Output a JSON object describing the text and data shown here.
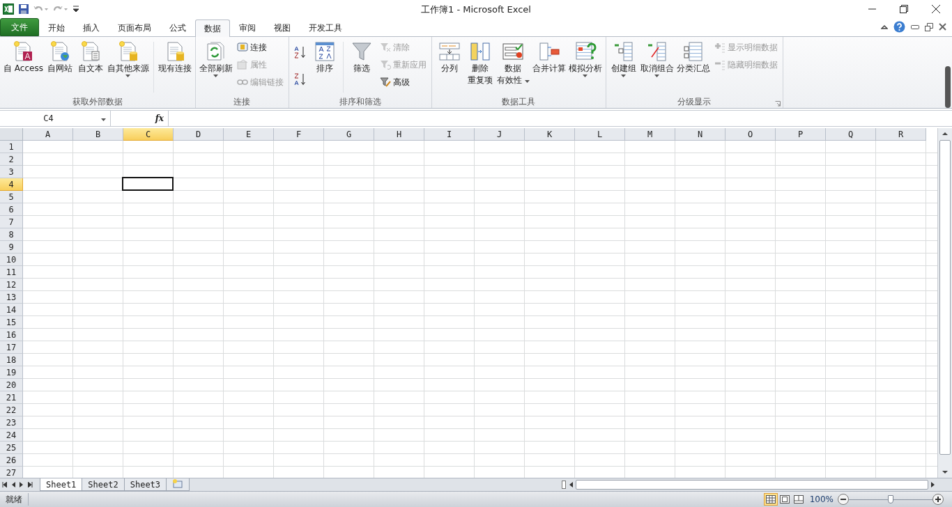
{
  "window": {
    "title": "工作簿1  -  Microsoft Excel"
  },
  "tabs": [
    {
      "label": "文件",
      "kind": "file",
      "selected": false
    },
    {
      "label": "开始",
      "kind": "tab",
      "selected": false
    },
    {
      "label": "插入",
      "kind": "tab",
      "selected": false
    },
    {
      "label": "页面布局",
      "kind": "tab",
      "selected": false
    },
    {
      "label": "公式",
      "kind": "tab",
      "selected": false
    },
    {
      "label": "数据",
      "kind": "tab",
      "selected": true
    },
    {
      "label": "审阅",
      "kind": "tab",
      "selected": false
    },
    {
      "label": "视图",
      "kind": "tab",
      "selected": false
    },
    {
      "label": "开发工具",
      "kind": "tab",
      "selected": false
    }
  ],
  "ribbon": {
    "groups": [
      {
        "label": "获取外部数据",
        "launcher": false,
        "items": [
          {
            "kind": "large",
            "lines": [
              "自 Access"
            ],
            "dropdown": false
          },
          {
            "kind": "large",
            "lines": [
              "自网站"
            ],
            "dropdown": false
          },
          {
            "kind": "large",
            "lines": [
              "自文本"
            ],
            "dropdown": false
          },
          {
            "kind": "large",
            "lines": [
              "自其他来源"
            ],
            "dropdown": true
          },
          {
            "kind": "separator"
          },
          {
            "kind": "large",
            "lines": [
              "现有连接"
            ],
            "dropdown": false
          }
        ]
      },
      {
        "label": "连接",
        "launcher": false,
        "items": [
          {
            "kind": "large",
            "lines": [
              "全部刷新"
            ],
            "dropdown": true
          },
          {
            "kind": "stack",
            "buttons": [
              {
                "label": "连接",
                "disabled": false
              },
              {
                "label": "属性",
                "disabled": true
              },
              {
                "label": "编辑链接",
                "disabled": true
              }
            ]
          }
        ]
      },
      {
        "label": "排序和筛选",
        "launcher": false,
        "items": [
          {
            "kind": "sort-pair"
          },
          {
            "kind": "large",
            "lines": [
              "排序"
            ],
            "dropdown": false
          },
          {
            "kind": "separator"
          },
          {
            "kind": "large",
            "lines": [
              "筛选"
            ],
            "dropdown": false
          },
          {
            "kind": "stack",
            "buttons": [
              {
                "label": "清除",
                "disabled": true
              },
              {
                "label": "重新应用",
                "disabled": true
              },
              {
                "label": "高级",
                "disabled": false
              }
            ]
          }
        ]
      },
      {
        "label": "数据工具",
        "launcher": false,
        "items": [
          {
            "kind": "large",
            "lines": [
              "分列"
            ],
            "dropdown": false
          },
          {
            "kind": "large",
            "lines": [
              "删除",
              "重复项"
            ],
            "dropdown": false
          },
          {
            "kind": "large",
            "lines": [
              "数据",
              "有效性"
            ],
            "dropdown": true
          },
          {
            "kind": "large",
            "lines": [
              "合并计算"
            ],
            "dropdown": false
          },
          {
            "kind": "large",
            "lines": [
              "模拟分析"
            ],
            "dropdown": true
          }
        ]
      },
      {
        "label": "分级显示",
        "launcher": true,
        "items": [
          {
            "kind": "large",
            "lines": [
              "创建组"
            ],
            "dropdown": true
          },
          {
            "kind": "large",
            "lines": [
              "取消组合"
            ],
            "dropdown": true
          },
          {
            "kind": "large",
            "lines": [
              "分类汇总"
            ],
            "dropdown": false
          },
          {
            "kind": "stack",
            "buttons": [
              {
                "label": "显示明细数据",
                "disabled": true
              },
              {
                "label": "隐藏明细数据",
                "disabled": true
              }
            ]
          }
        ]
      }
    ]
  },
  "formula_bar": {
    "name_box": "C4",
    "function_label": "fx"
  },
  "grid": {
    "columns": [
      {
        "label": "A",
        "selected": false
      },
      {
        "label": "B",
        "selected": false
      },
      {
        "label": "C",
        "selected": true
      },
      {
        "label": "D",
        "selected": false
      },
      {
        "label": "E",
        "selected": false
      },
      {
        "label": "F",
        "selected": false
      },
      {
        "label": "G",
        "selected": false
      },
      {
        "label": "H",
        "selected": false
      },
      {
        "label": "I",
        "selected": false
      },
      {
        "label": "J",
        "selected": false
      },
      {
        "label": "K",
        "selected": false
      },
      {
        "label": "L",
        "selected": false
      },
      {
        "label": "M",
        "selected": false
      },
      {
        "label": "N",
        "selected": false
      },
      {
        "label": "O",
        "selected": false
      },
      {
        "label": "P",
        "selected": false
      },
      {
        "label": "Q",
        "selected": false
      },
      {
        "label": "R",
        "selected": false
      }
    ],
    "rows": [
      {
        "label": "1",
        "selected": false
      },
      {
        "label": "2",
        "selected": false
      },
      {
        "label": "3",
        "selected": false
      },
      {
        "label": "4",
        "selected": true
      },
      {
        "label": "5",
        "selected": false
      },
      {
        "label": "6",
        "selected": false
      },
      {
        "label": "7",
        "selected": false
      },
      {
        "label": "8",
        "selected": false
      },
      {
        "label": "9",
        "selected": false
      },
      {
        "label": "10",
        "selected": false
      },
      {
        "label": "11",
        "selected": false
      },
      {
        "label": "12",
        "selected": false
      },
      {
        "label": "13",
        "selected": false
      },
      {
        "label": "14",
        "selected": false
      },
      {
        "label": "15",
        "selected": false
      },
      {
        "label": "16",
        "selected": false
      },
      {
        "label": "17",
        "selected": false
      },
      {
        "label": "18",
        "selected": false
      },
      {
        "label": "19",
        "selected": false
      },
      {
        "label": "20",
        "selected": false
      },
      {
        "label": "21",
        "selected": false
      },
      {
        "label": "22",
        "selected": false
      },
      {
        "label": "23",
        "selected": false
      },
      {
        "label": "24",
        "selected": false
      },
      {
        "label": "25",
        "selected": false
      },
      {
        "label": "26",
        "selected": false
      },
      {
        "label": "27",
        "selected": false
      }
    ]
  },
  "sheet_tabs": [
    {
      "label": "Sheet1",
      "selected": true
    },
    {
      "label": "Sheet2",
      "selected": false
    },
    {
      "label": "Sheet3",
      "selected": false
    }
  ],
  "status_bar": {
    "status": "就绪",
    "views": [
      {
        "selected": true
      },
      {
        "selected": false
      },
      {
        "selected": false
      }
    ],
    "zoom": "100%",
    "zoom_slider": {
      "level": 0.5
    }
  }
}
